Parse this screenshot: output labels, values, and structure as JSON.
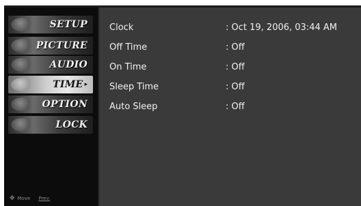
{
  "menu": {
    "items": [
      {
        "label": "SETUP",
        "icon": "setup-thumbnail-icon"
      },
      {
        "label": "PICTURE",
        "icon": "picture-thumbnail-icon"
      },
      {
        "label": "AUDIO",
        "icon": "audio-thumbnail-icon"
      },
      {
        "label": "TIME",
        "icon": "time-thumbnail-icon",
        "selected": true
      },
      {
        "label": "OPTION",
        "icon": "option-thumbnail-icon"
      },
      {
        "label": "LOCK",
        "icon": "lock-thumbnail-icon"
      }
    ],
    "selected_arrow": "▸"
  },
  "footer": {
    "move_glyph": "✥",
    "move_label": "Move",
    "prev_label": "Prev."
  },
  "time_settings": {
    "rows": [
      {
        "name": "Clock",
        "value": ": Oct 19, 2006, 03:44 AM"
      },
      {
        "name": "Off Time",
        "value": ": Off"
      },
      {
        "name": "On Time",
        "value": ": Off"
      },
      {
        "name": "Sleep Time",
        "value": ": Off"
      },
      {
        "name": "Auto Sleep",
        "value": ": Off"
      }
    ]
  },
  "colors": {
    "panel_background": "#3a3a3a",
    "sidebar_background": "#0c0c0c",
    "text": "#f2f2f2",
    "selected_highlight": "#cfcfcf"
  }
}
